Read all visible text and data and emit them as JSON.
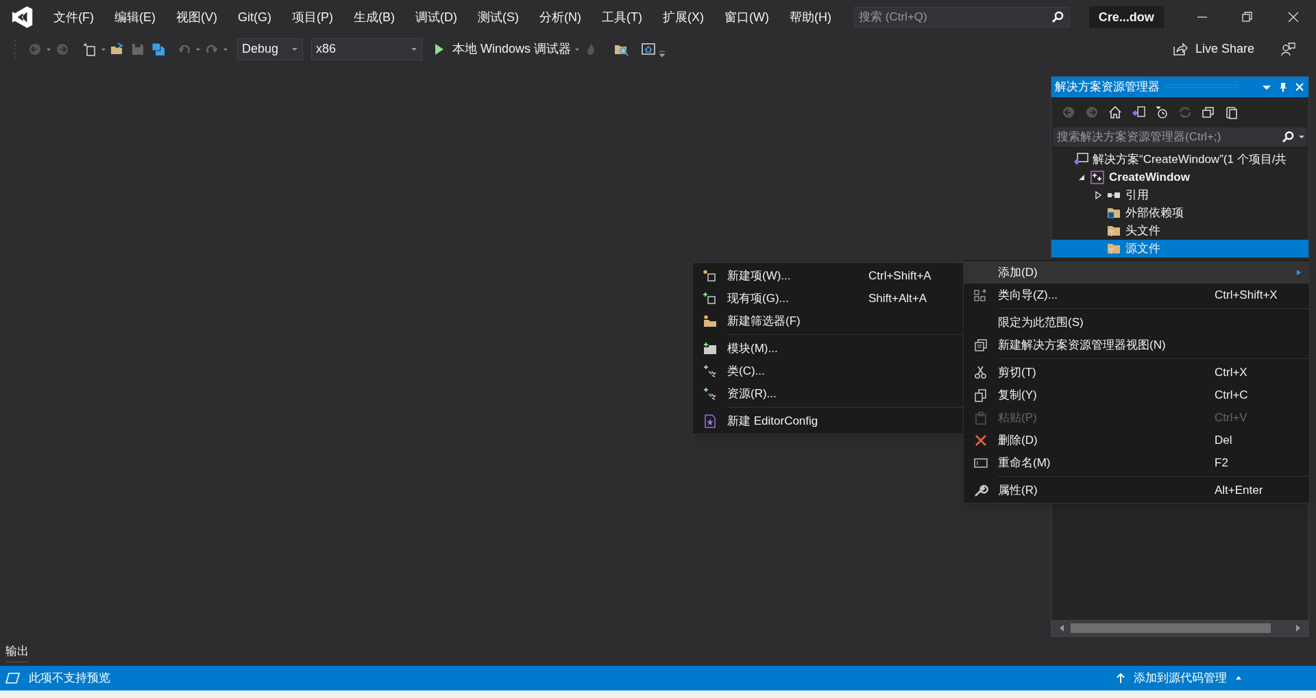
{
  "menu_bar": [
    "文件(F)",
    "编辑(E)",
    "视图(V)",
    "Git(G)",
    "项目(P)",
    "生成(B)",
    "调试(D)",
    "测试(S)",
    "分析(N)",
    "工具(T)",
    "扩展(X)",
    "窗口(W)",
    "帮助(H)"
  ],
  "search": {
    "placeholder": "搜索 (Ctrl+Q)"
  },
  "window_title": "Cre...dow",
  "toolbar": {
    "configuration": "Debug",
    "platform": "x86",
    "run_label": "本地 Windows 调试器",
    "live_share": "Live Share"
  },
  "solution_explorer": {
    "title": "解决方案资源管理器",
    "search": {
      "placeholder": "搜索解决方案资源管理器(Ctrl+;)"
    },
    "tree": [
      {
        "label": "解决方案“CreateWindow”(1 个项目/共",
        "kind": "solution",
        "selected": false,
        "children": [
          {
            "label": "CreateWindow",
            "kind": "project",
            "expanded": true,
            "selected": false,
            "children": [
              {
                "label": "引用",
                "kind": "references",
                "expanded": false,
                "selected": false
              },
              {
                "label": "外部依赖项",
                "kind": "external",
                "selected": false
              },
              {
                "label": "头文件",
                "kind": "filter",
                "selected": false
              },
              {
                "label": "源文件",
                "kind": "filter",
                "selected": true
              }
            ]
          }
        ]
      }
    ]
  },
  "context_menu": {
    "items": [
      {
        "kind": "item",
        "label": "添加(D)",
        "selected": true,
        "submenu": true,
        "disabled": false
      },
      {
        "kind": "item",
        "label": "类向导(Z)...",
        "shortcut": "Ctrl+Shift+X",
        "selected": false,
        "submenu": false,
        "disabled": false
      },
      {
        "kind": "separator"
      },
      {
        "kind": "item",
        "label": "限定为此范围(S)",
        "selected": false,
        "submenu": false,
        "disabled": false
      },
      {
        "kind": "item",
        "label": "新建解决方案资源管理器视图(N)",
        "selected": false,
        "submenu": false,
        "disabled": false
      },
      {
        "kind": "separator"
      },
      {
        "kind": "item",
        "label": "剪切(T)",
        "shortcut": "Ctrl+X",
        "selected": false,
        "submenu": false,
        "disabled": false
      },
      {
        "kind": "item",
        "label": "复制(Y)",
        "shortcut": "Ctrl+C",
        "selected": false,
        "submenu": false,
        "disabled": false
      },
      {
        "kind": "item",
        "label": "粘贴(P)",
        "shortcut": "Ctrl+V",
        "selected": false,
        "submenu": false,
        "disabled": true
      },
      {
        "kind": "item",
        "label": "删除(D)",
        "shortcut": "Del",
        "selected": false,
        "submenu": false,
        "disabled": false
      },
      {
        "kind": "item",
        "label": "重命名(M)",
        "shortcut": "F2",
        "selected": false,
        "submenu": false,
        "disabled": false
      },
      {
        "kind": "separator"
      },
      {
        "kind": "item",
        "label": "属性(R)",
        "shortcut": "Alt+Enter",
        "selected": false,
        "submenu": false,
        "disabled": false
      }
    ]
  },
  "submenu": {
    "items": [
      {
        "kind": "item",
        "label": "新建项(W)...",
        "shortcut": "Ctrl+Shift+A"
      },
      {
        "kind": "item",
        "label": "现有项(G)...",
        "shortcut": "Shift+Alt+A"
      },
      {
        "kind": "item",
        "label": "新建筛选器(F)"
      },
      {
        "kind": "separator"
      },
      {
        "kind": "item",
        "label": "模块(M)..."
      },
      {
        "kind": "item",
        "label": "类(C)..."
      },
      {
        "kind": "item",
        "label": "资源(R)..."
      },
      {
        "kind": "separator"
      },
      {
        "kind": "item",
        "label": "新建 EditorConfig"
      }
    ]
  },
  "output_tab": "输出",
  "status_bar": {
    "message": "此项不支持预览",
    "source_control": "添加到源代码管理"
  }
}
